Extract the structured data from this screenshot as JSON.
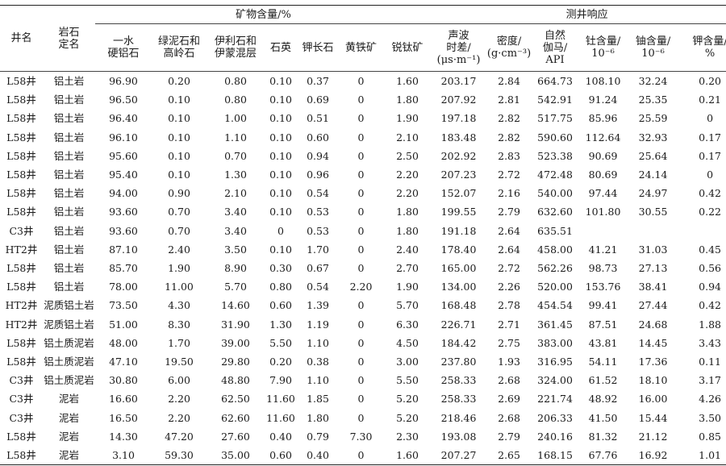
{
  "headers": {
    "well": "井名",
    "rock_line1": "岩石",
    "rock_line2": "定名",
    "group_mineral": "矿物含量/%",
    "group_logging": "测井响应",
    "cols": [
      [
        "一水",
        "硬铝石"
      ],
      [
        "绿泥石和",
        "高岭石"
      ],
      [
        "伊利石和",
        "伊蒙混层"
      ],
      [
        "石英"
      ],
      [
        "钾长石"
      ],
      [
        "黄铁矿"
      ],
      [
        "锐钛矿"
      ],
      [
        "声波",
        "时差/",
        "(μs·m⁻¹)"
      ],
      [
        "密度/",
        "(g·cm⁻³)"
      ],
      [
        "自然",
        "伽马/",
        "API"
      ],
      [
        "钍含量/",
        "10⁻⁶"
      ],
      [
        "铀含量/",
        "10⁻⁶"
      ],
      [
        "钾含量/",
        "%"
      ]
    ]
  },
  "rows": [
    [
      "L58井",
      "铝土岩",
      "96.90",
      "0.20",
      "0.80",
      "0.10",
      "0.37",
      "0",
      "1.60",
      "203.17",
      "2.84",
      "664.73",
      "108.10",
      "32.24",
      "0.20"
    ],
    [
      "L58井",
      "铝土岩",
      "96.50",
      "0.10",
      "0.80",
      "0.10",
      "0.69",
      "0",
      "1.80",
      "207.92",
      "2.81",
      "542.91",
      "91.24",
      "25.35",
      "0.21"
    ],
    [
      "L58井",
      "铝土岩",
      "96.40",
      "0.10",
      "1.00",
      "0.10",
      "0.51",
      "0",
      "1.90",
      "197.18",
      "2.82",
      "517.75",
      "85.96",
      "25.59",
      "0"
    ],
    [
      "L58井",
      "铝土岩",
      "96.10",
      "0.10",
      "1.10",
      "0.10",
      "0.60",
      "0",
      "2.10",
      "183.48",
      "2.82",
      "590.60",
      "112.64",
      "32.93",
      "0.17"
    ],
    [
      "L58井",
      "铝土岩",
      "95.60",
      "0.10",
      "0.70",
      "0.10",
      "0.94",
      "0",
      "2.50",
      "202.92",
      "2.83",
      "523.38",
      "90.69",
      "25.64",
      "0.17"
    ],
    [
      "L58井",
      "铝土岩",
      "95.40",
      "0.10",
      "1.30",
      "0.10",
      "0.96",
      "0",
      "2.20",
      "207.23",
      "2.72",
      "472.48",
      "80.69",
      "24.14",
      "0"
    ],
    [
      "L58井",
      "铝土岩",
      "94.00",
      "0.90",
      "2.10",
      "0.10",
      "0.54",
      "0",
      "2.20",
      "152.07",
      "2.16",
      "540.00",
      "97.44",
      "24.97",
      "0.42"
    ],
    [
      "L58井",
      "铝土岩",
      "93.60",
      "0.70",
      "3.40",
      "0.10",
      "0.53",
      "0",
      "1.80",
      "199.55",
      "2.79",
      "632.60",
      "101.80",
      "30.55",
      "0.22"
    ],
    [
      "C3井",
      "铝土岩",
      "93.60",
      "0.70",
      "3.40",
      "0",
      "0.53",
      "0",
      "1.80",
      "191.18",
      "2.64",
      "635.51",
      "",
      "",
      ""
    ],
    [
      "HT2井",
      "铝土岩",
      "87.10",
      "2.40",
      "3.50",
      "0.10",
      "1.70",
      "0",
      "2.40",
      "178.40",
      "2.64",
      "458.00",
      "41.21",
      "31.03",
      "0.45"
    ],
    [
      "L58井",
      "铝土岩",
      "85.70",
      "1.90",
      "8.90",
      "0.30",
      "0.67",
      "0",
      "2.70",
      "165.00",
      "2.72",
      "562.26",
      "98.73",
      "27.13",
      "0.56"
    ],
    [
      "L58井",
      "铝土岩",
      "78.00",
      "11.00",
      "5.70",
      "0.80",
      "0.54",
      "2.20",
      "1.90",
      "134.00",
      "2.26",
      "520.00",
      "153.76",
      "38.41",
      "0.94"
    ],
    [
      "HT2井",
      "泥质铝土岩",
      "73.50",
      "4.30",
      "14.60",
      "0.60",
      "1.39",
      "0",
      "5.70",
      "168.48",
      "2.78",
      "454.54",
      "99.41",
      "27.44",
      "0.42"
    ],
    [
      "HT2井",
      "泥质铝土岩",
      "51.00",
      "8.30",
      "31.90",
      "1.30",
      "1.19",
      "0",
      "6.30",
      "226.71",
      "2.71",
      "361.45",
      "87.51",
      "24.68",
      "1.88"
    ],
    [
      "L58井",
      "铝土质泥岩",
      "48.00",
      "1.70",
      "39.00",
      "5.50",
      "1.10",
      "0",
      "4.50",
      "184.42",
      "2.75",
      "383.00",
      "43.81",
      "14.45",
      "3.43"
    ],
    [
      "L58井",
      "铝土质泥岩",
      "47.10",
      "19.50",
      "29.80",
      "0.20",
      "0.38",
      "0",
      "3.00",
      "237.80",
      "1.93",
      "316.95",
      "54.11",
      "17.36",
      "0.11"
    ],
    [
      "C3井",
      "铝土质泥岩",
      "30.80",
      "6.00",
      "48.80",
      "7.90",
      "1.10",
      "0",
      "5.50",
      "258.33",
      "2.68",
      "324.00",
      "61.52",
      "18.10",
      "3.17"
    ],
    [
      "C3井",
      "泥岩",
      "16.60",
      "2.20",
      "62.50",
      "11.60",
      "1.85",
      "0",
      "5.20",
      "258.33",
      "2.69",
      "221.74",
      "48.92",
      "16.00",
      "4.26"
    ],
    [
      "C3井",
      "泥岩",
      "16.50",
      "2.20",
      "62.60",
      "11.60",
      "1.80",
      "0",
      "5.20",
      "218.46",
      "2.68",
      "206.33",
      "41.50",
      "15.44",
      "3.50"
    ],
    [
      "L58井",
      "泥岩",
      "14.30",
      "47.20",
      "27.60",
      "0.40",
      "0.79",
      "7.30",
      "2.30",
      "193.08",
      "2.79",
      "240.16",
      "81.32",
      "21.12",
      "0.85"
    ],
    [
      "L58井",
      "泥岩",
      "3.10",
      "59.30",
      "35.00",
      "0.60",
      "0.40",
      "0",
      "1.60",
      "207.27",
      "2.65",
      "168.15",
      "67.76",
      "16.92",
      "1.01"
    ]
  ]
}
